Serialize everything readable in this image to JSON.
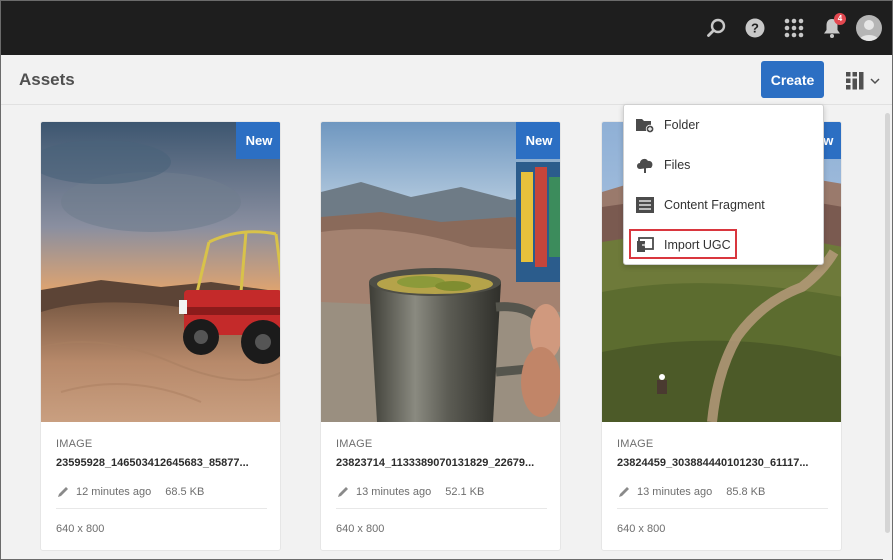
{
  "shell": {
    "icons": [
      "search-icon",
      "help-icon",
      "apps-grid-icon",
      "bell-icon",
      "user-avatar"
    ],
    "notification_count": "4"
  },
  "actionbar": {
    "title": "Assets",
    "create_label": "Create",
    "view_icon": "column-view-icon"
  },
  "create_menu": {
    "items": [
      {
        "label": "Folder",
        "icon": "folder-add-icon"
      },
      {
        "label": "Files",
        "icon": "cloud-upload-icon"
      },
      {
        "label": "Content Fragment",
        "icon": "content-fragment-icon"
      },
      {
        "label": "Import UGC",
        "icon": "import-ugc-icon"
      }
    ],
    "highlighted": "Import UGC",
    "highlight_color": "#d9363e"
  },
  "cards": [
    {
      "badge": "New",
      "type": "IMAGE",
      "name": "23595928_146503412645683_85877...",
      "modified": "12 minutes ago",
      "size": "68.5 KB",
      "dimensions": "640 x 800"
    },
    {
      "badge": "New",
      "type": "IMAGE",
      "name": "23823714_1133389070131829_22679...",
      "modified": "13 minutes ago",
      "size": "52.1 KB",
      "dimensions": "640 x 800"
    },
    {
      "badge": "New",
      "type": "IMAGE",
      "name": "23824459_303884440101230_61117...",
      "modified": "13 minutes ago",
      "size": "85.8 KB",
      "dimensions": "640 x 800"
    }
  ],
  "colors": {
    "shell": "#1e1e1e",
    "accent": "#2c6fc3",
    "badge": "#e34850"
  }
}
